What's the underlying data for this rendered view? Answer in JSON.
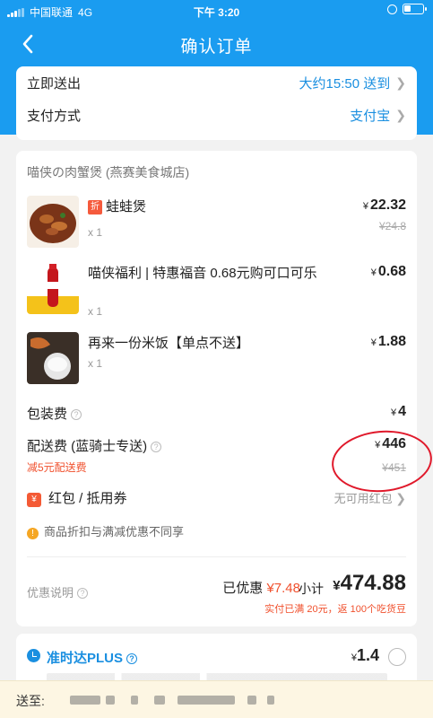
{
  "status_bar": {
    "carrier": "中国联通",
    "network": "4G",
    "time": "下午 3:20",
    "battery_level": 0.35
  },
  "nav": {
    "back_icon": "back-arrow-icon",
    "title": "确认订单"
  },
  "delivery": {
    "send_label": "立即送出",
    "send_value": "大约15:50 送到",
    "payment_label": "支付方式",
    "payment_value": "支付宝"
  },
  "shop": {
    "name": "喵侠の肉蟹煲 (燕赛美食城店)"
  },
  "items": [
    {
      "name": "蛙蛙煲",
      "discount_tag": "折",
      "qty": "x 1",
      "currency": "¥",
      "price": "22.32",
      "old_price": "¥24.8"
    },
    {
      "name": "喵侠福利 | 特惠福音 0.68元购可口可乐",
      "qty": "x 1",
      "currency": "¥",
      "price": "0.68"
    },
    {
      "name": "再来一份米饭【单点不送】",
      "qty": "x 1",
      "currency": "¥",
      "price": "1.88"
    }
  ],
  "fees": {
    "packing_label": "包装费",
    "packing_currency": "¥",
    "packing_value": "4",
    "delivery_label": "配送费 (蓝骑士专送)",
    "delivery_currency": "¥",
    "delivery_value": "446",
    "delivery_old": "¥451",
    "delivery_note": "减5元配送费"
  },
  "redpack": {
    "icon": "¥",
    "label": "红包 / 抵用券",
    "value": "无可用红包"
  },
  "notice": {
    "icon": "!",
    "text": "商品折扣与满减优惠不同享"
  },
  "summary": {
    "promo_label": "优惠说明",
    "saved_label": "已优惠",
    "saved_value": "¥7.48",
    "subtotal_label": "小计",
    "subtotal_currency": "¥",
    "subtotal_value": "474.88",
    "cashback": "实付已满 20元，返 100个吃货豆"
  },
  "ontime": {
    "title": "准时达PLUS",
    "currency": "¥",
    "price": "1.4"
  },
  "address": {
    "label": "送至:"
  },
  "colors": {
    "brand_blue": "#1a9cf0",
    "link_blue": "#1a8fe0",
    "discount_red": "#f0502d",
    "annotation_red": "#e0192b"
  }
}
